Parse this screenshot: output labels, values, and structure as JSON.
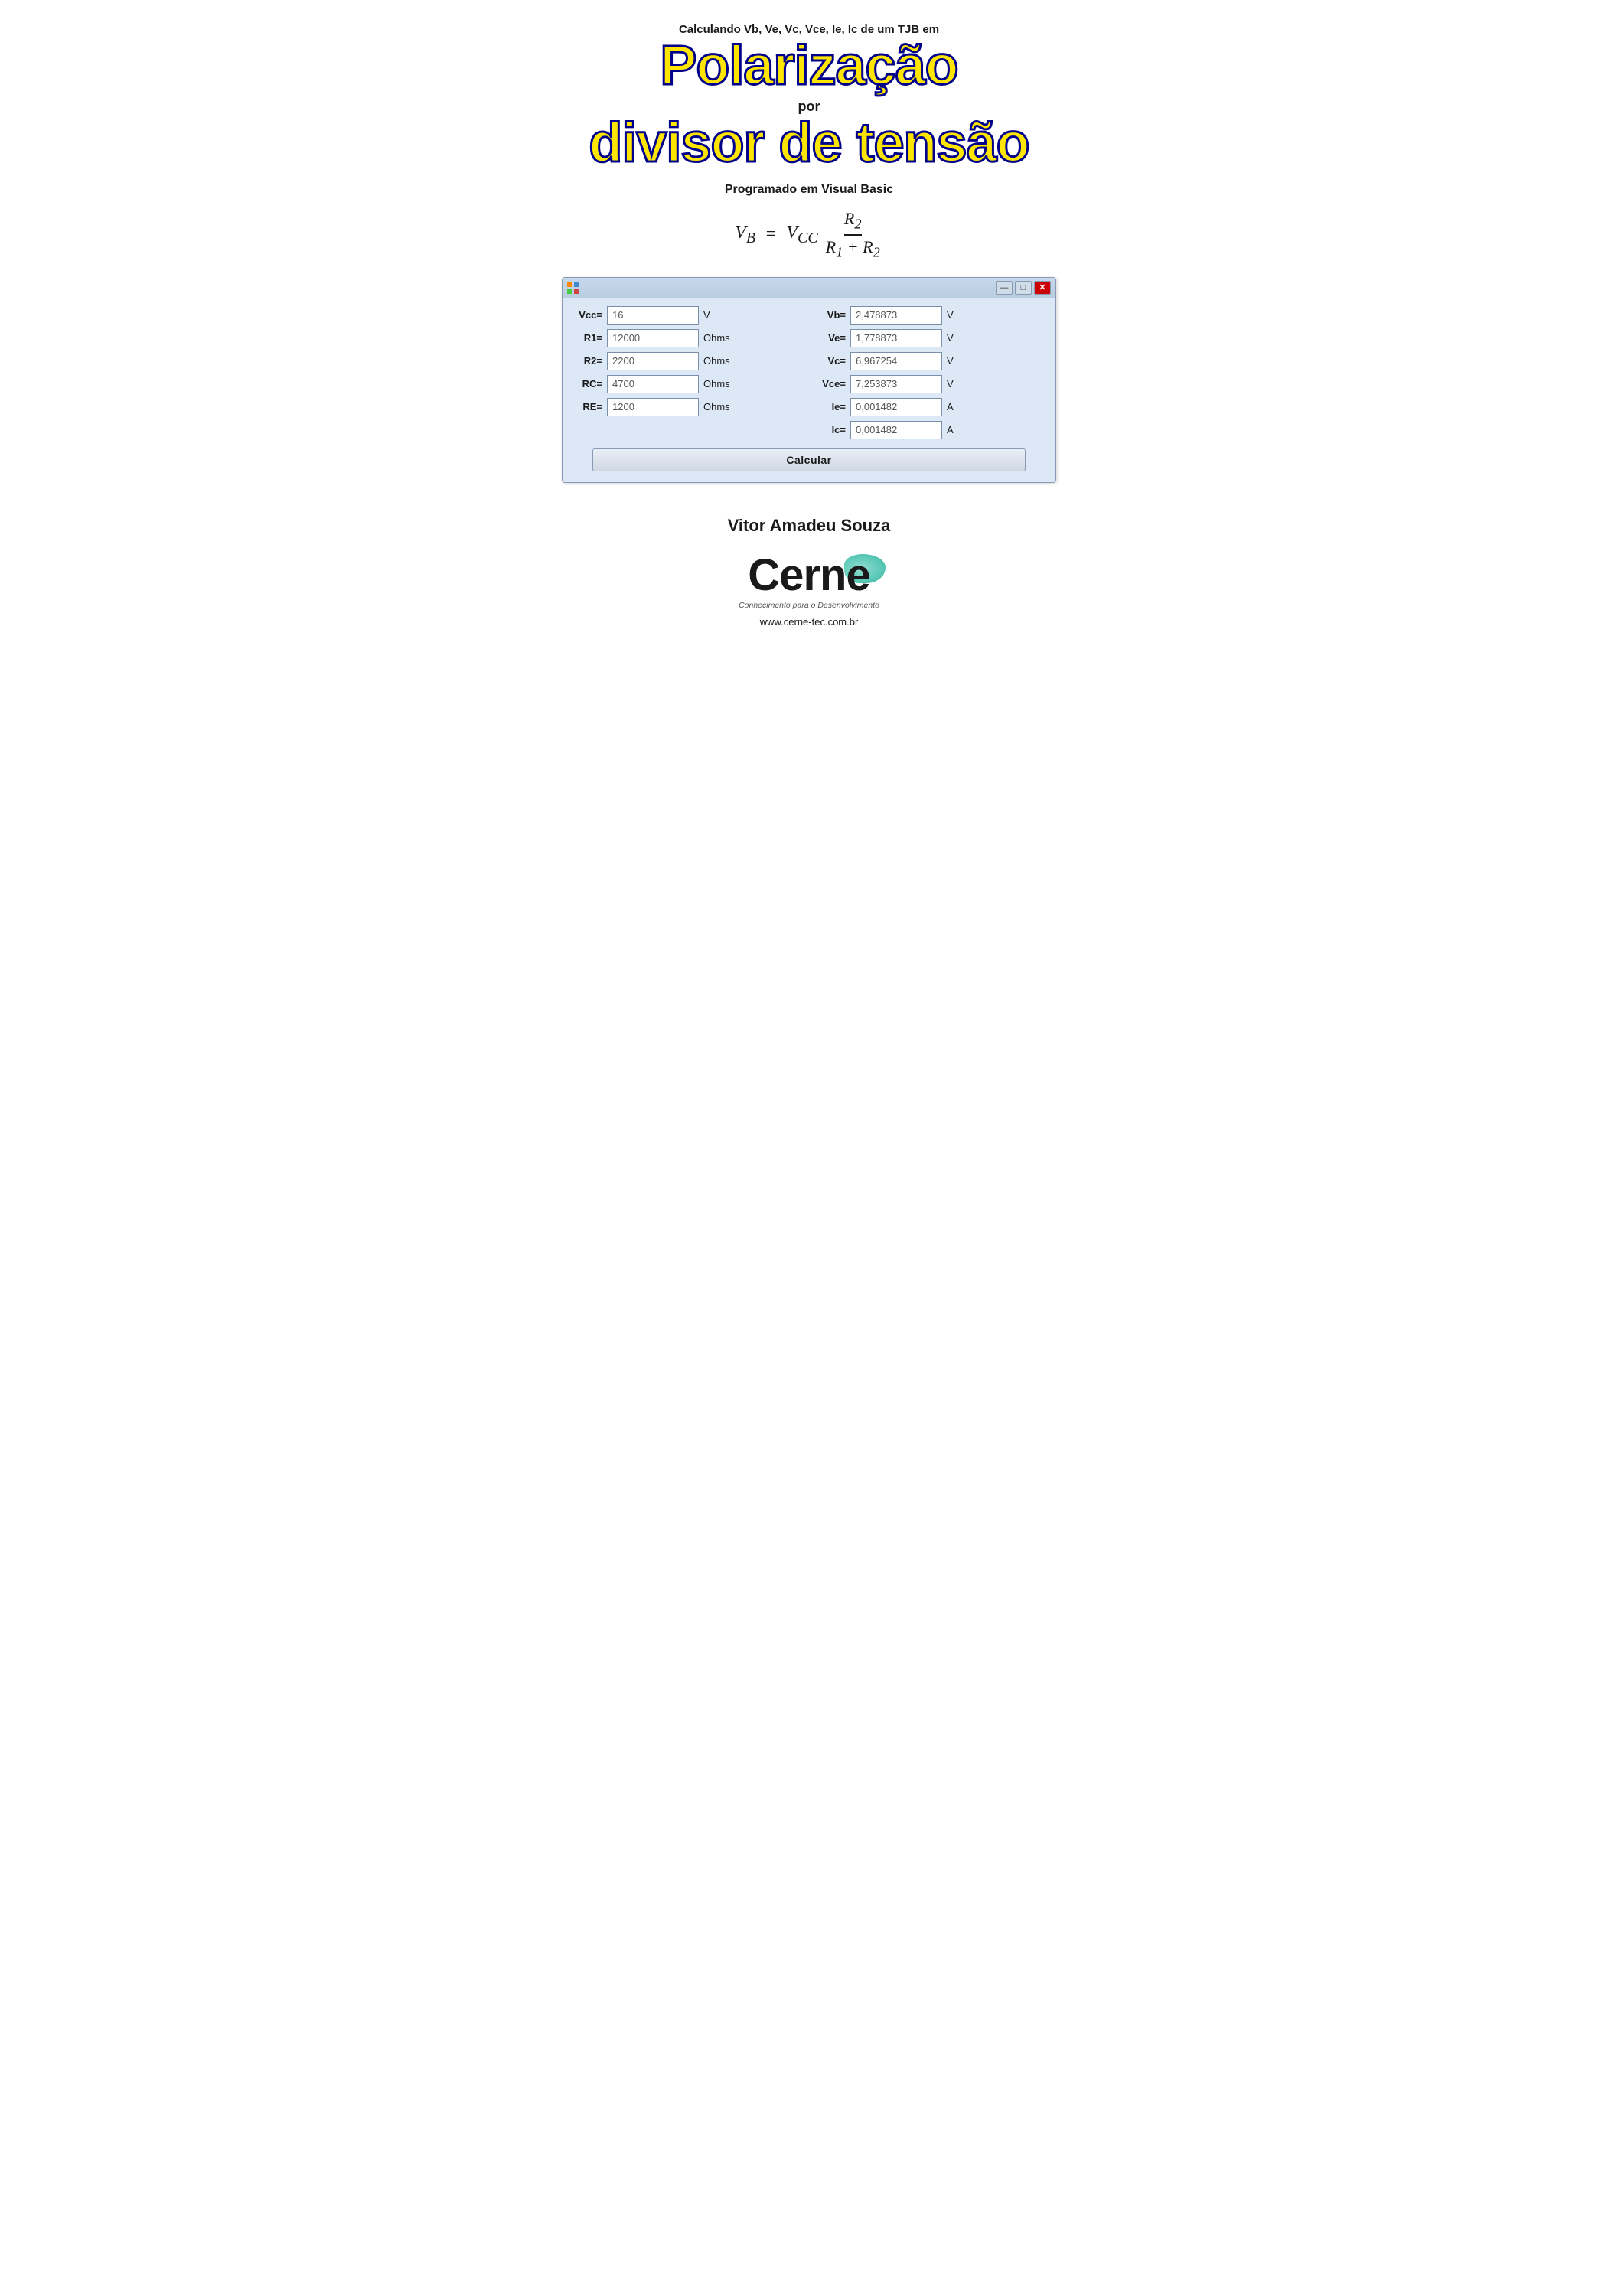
{
  "header": {
    "subtitle": "Calculando Vb, Ve, Vc, Vce, Ie, Ic de um TJB em",
    "title_line1": "Polarização",
    "por_label": "por",
    "title_line2": "divisor de tensão",
    "programado": "Programado em Visual Basic"
  },
  "formula": {
    "lhs": "V",
    "lhs_sub": "B",
    "eq": "=",
    "vcc": "V",
    "vcc_sub": "CC",
    "numer": "R",
    "numer_sub": "2",
    "denom1": "R",
    "denom1_sub": "1",
    "plus": "+",
    "denom2": "R",
    "denom2_sub": "2"
  },
  "window": {
    "titlebar": {},
    "controls": {
      "minimize": "—",
      "restore": "□",
      "close": "✕"
    },
    "inputs": {
      "vcc_label": "Vcc=",
      "vcc_value": "16",
      "vcc_unit": "V",
      "r1_label": "R1=",
      "r1_value": "12000",
      "r1_unit": "Ohms",
      "r2_label": "R2=",
      "r2_value": "2200",
      "r2_unit": "Ohms",
      "rc_label": "RC=",
      "rc_value": "4700",
      "rc_unit": "Ohms",
      "re_label": "RE=",
      "re_value": "1200",
      "re_unit": "Ohms"
    },
    "outputs": {
      "vb_label": "Vb=",
      "vb_value": "2,478873",
      "vb_unit": "V",
      "ve_label": "Ve=",
      "ve_value": "1,778873",
      "ve_unit": "V",
      "vc_label": "Vc=",
      "vc_value": "6,967254",
      "vc_unit": "V",
      "vce_label": "Vce=",
      "vce_value": "7,253873",
      "vce_unit": "V",
      "ie_label": "Ie=",
      "ie_value": "0,001482",
      "ie_unit": "A",
      "ic_label": "Ic=",
      "ic_value": "0,001482",
      "ic_unit": "A"
    },
    "button_label": "Calcular"
  },
  "author": "Vitor Amadeu Souza",
  "logo": {
    "name": "Cerne",
    "tagline": "Conhecimento para o Desenvolvimento",
    "website": "www.cerne-tec.com.br"
  }
}
